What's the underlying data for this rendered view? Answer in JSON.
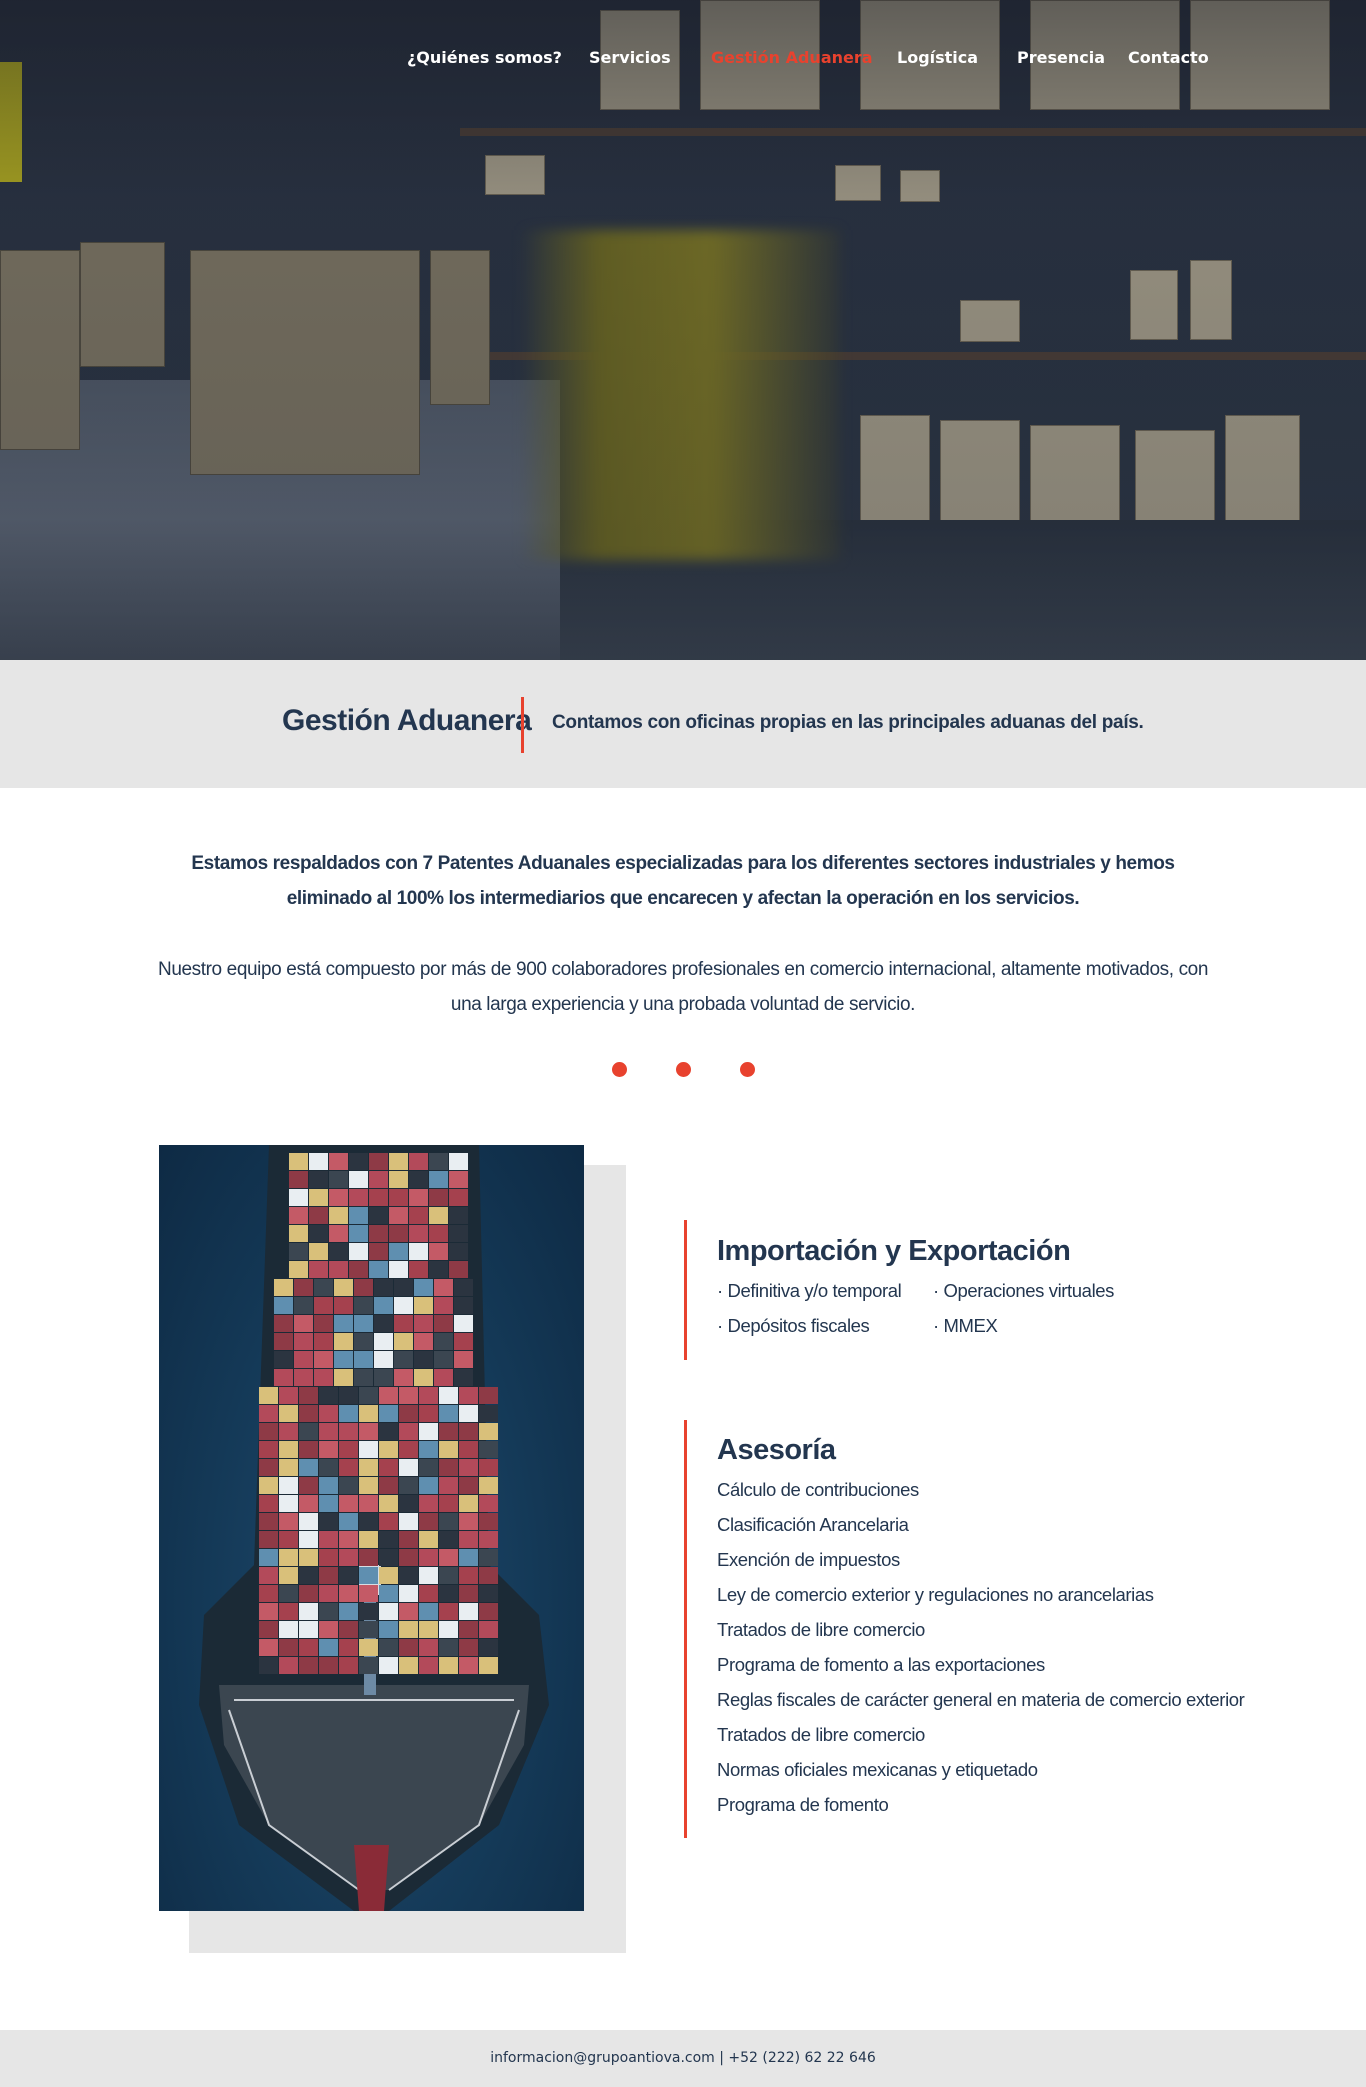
{
  "nav": {
    "items": [
      {
        "label": "¿Quiénes somos?"
      },
      {
        "label": "Servicios"
      },
      {
        "label": "Gestión Aduanera"
      },
      {
        "label": "Logística"
      },
      {
        "label": "Presencia"
      },
      {
        "label": "Contacto"
      }
    ],
    "active": "Gestión Aduanera"
  },
  "banner": {
    "title": "Gestión Aduanera",
    "subtitle": "Contamos con oficinas propias en las principales aduanas del país."
  },
  "intro": {
    "p1": "Estamos respaldados con 7 Patentes Aduanales especializadas para los diferentes sectores industriales y hemos eliminado al 100% los intermediarios que encarecen y afectan la operación en los servicios.",
    "p2": "Nuestro equipo está compuesto por más de 900 colaboradores profesionales en comercio internacional, altamente  motivados, con una larga experiencia y una probada voluntad de servicio."
  },
  "services": {
    "import_export": {
      "title": "Importación y Exportación",
      "items": [
        "· Definitiva y/o temporal",
        "· Operaciones virtuales",
        "· Depósitos fiscales",
        "· MMEX"
      ]
    },
    "advisory": {
      "title": "Asesoría",
      "items": [
        "Cálculo de contribuciones",
        "Clasificación Arancelaria",
        "Exención de impuestos",
        "Ley de comercio exterior y regulaciones no arancelarias",
        "Tratados de libre comercio",
        "Programa de fomento a las exportaciones",
        "Reglas fiscales de carácter general en materia de comercio exterior",
        "Tratados de libre comercio",
        "Normas oficiales mexicanas y etiquetado",
        "Programa de fomento"
      ]
    }
  },
  "footer": {
    "contact": "informacion@grupoantiova.com | +52 (222) 62 22 646"
  },
  "colors": {
    "accent": "#e8422e",
    "navy": "#23364f",
    "band_gray": "#e6e6e6"
  }
}
